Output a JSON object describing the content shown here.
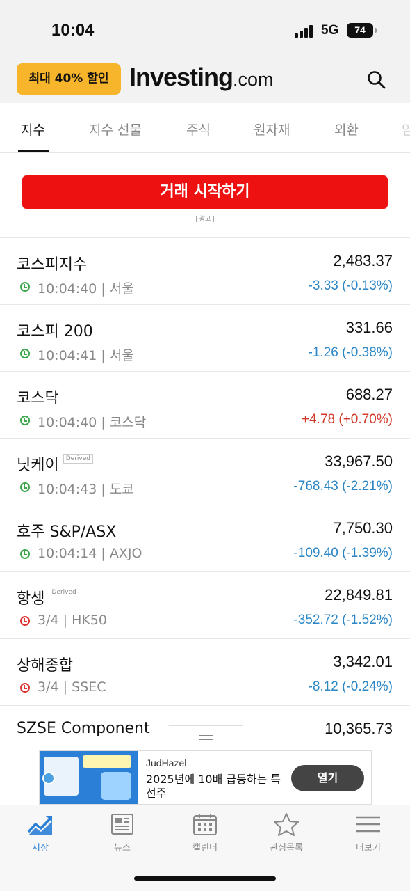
{
  "status_bar": {
    "time": "10:04",
    "network": "5G",
    "battery": "74"
  },
  "header": {
    "promo_label": "최대 40% 할인",
    "logo_main": "Investing",
    "logo_suffix": ".com"
  },
  "tabs": [
    "지수",
    "지수 선물",
    "주식",
    "원자재",
    "외환",
    "암"
  ],
  "ad": {
    "button_label": "거래 시작하기",
    "ad_label": "| 광고 |"
  },
  "derived_label": "Derived",
  "rows": [
    {
      "name": "코스피지수",
      "price": "2,483.37",
      "time": "10:04:40",
      "exchange": "서울",
      "change": "-3.33 (-0.13%)",
      "trend": "down",
      "clock": "green",
      "derived": false
    },
    {
      "name": "코스피 200",
      "price": "331.66",
      "time": "10:04:41",
      "exchange": "서울",
      "change": "-1.26 (-0.38%)",
      "trend": "down",
      "clock": "green",
      "derived": false
    },
    {
      "name": "코스닥",
      "price": "688.27",
      "time": "10:04:40",
      "exchange": "코스닥",
      "change": "+4.78 (+0.70%)",
      "trend": "up",
      "clock": "green",
      "derived": false
    },
    {
      "name": "닛케이",
      "price": "33,967.50",
      "time": "10:04:43",
      "exchange": "도쿄",
      "change": "-768.43 (-2.21%)",
      "trend": "down",
      "clock": "green",
      "derived": true
    },
    {
      "name": "호주 S&P/ASX",
      "price": "7,750.30",
      "time": "10:04:14",
      "exchange": "AXJO",
      "change": "-109.40 (-1.39%)",
      "trend": "down",
      "clock": "green",
      "derived": false
    },
    {
      "name": "항셍",
      "price": "22,849.81",
      "time": "3/4",
      "exchange": "HK50",
      "change": "-352.72 (-1.52%)",
      "trend": "down",
      "clock": "red",
      "derived": true
    },
    {
      "name": "상해종합",
      "price": "3,342.01",
      "time": "3/4",
      "exchange": "SSEC",
      "change": "-8.12 (-0.24%)",
      "trend": "down",
      "clock": "red",
      "derived": false
    },
    {
      "name": "SZSE Component",
      "price": "10,365.73",
      "time": "",
      "exchange": "",
      "change": "",
      "trend": "down",
      "clock": "none",
      "derived": false
    }
  ],
  "bottom_ad": {
    "sponsor": "JudHazel",
    "text": "2025년에 10배 급등하는 특선주",
    "button_label": "열기"
  },
  "nav": [
    {
      "label": "시장",
      "icon": "chart-trend-icon",
      "active": true
    },
    {
      "label": "뉴스",
      "icon": "newspaper-icon",
      "active": false
    },
    {
      "label": "캘린더",
      "icon": "calendar-icon",
      "active": false
    },
    {
      "label": "관심목록",
      "icon": "star-icon",
      "active": false
    },
    {
      "label": "더보기",
      "icon": "menu-icon",
      "active": false
    }
  ],
  "colors": {
    "down": "#2b86c5",
    "up": "#d23a2a",
    "accent": "#2b7fd6",
    "promo": "#f7b52c",
    "trade_button": "#ee1111"
  }
}
